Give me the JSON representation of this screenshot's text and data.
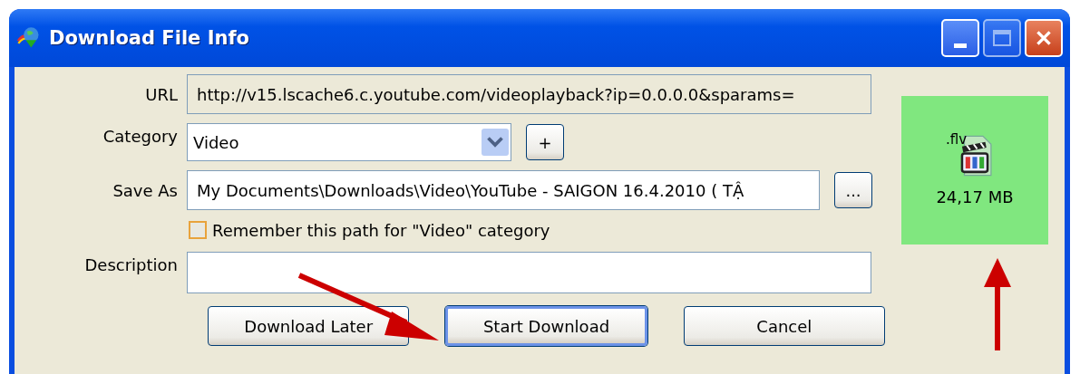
{
  "window": {
    "title": "Download File Info"
  },
  "url": {
    "label": "URL",
    "value": "http://v15.lscache6.c.youtube.com/videoplayback?ip=0.0.0.0&sparams="
  },
  "category": {
    "label": "Category",
    "value": "Video",
    "add_button": "+"
  },
  "save_as": {
    "label": "Save As",
    "value": "My Documents\\Downloads\\Video\\YouTube - SAIGON 16.4.2010 ( TẬ",
    "browse_button": "..."
  },
  "remember": {
    "label": "Remember this path for \"Video\" category",
    "checked": false
  },
  "description": {
    "label": "Description"
  },
  "buttons": [
    {
      "label": "Download Later",
      "default": false
    },
    {
      "label": "Start Download",
      "default": true
    },
    {
      "label": "Cancel",
      "default": false
    }
  ],
  "file": {
    "extension": ".flv",
    "size": "24,17  MB"
  }
}
